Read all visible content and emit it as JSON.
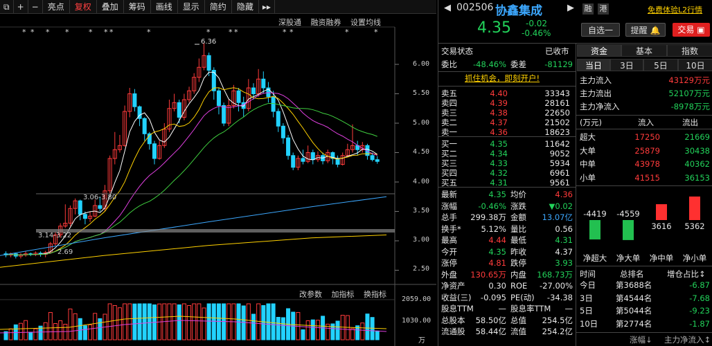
{
  "toolbar": {
    "items": [
      "亮点",
      "复权",
      "叠加",
      "筹码",
      "画线",
      "显示",
      "简约",
      "隐藏"
    ],
    "active": "复权"
  },
  "chart": {
    "sublinks_top": [
      "深股通",
      "融资融券",
      "设置均线"
    ],
    "sublinks_bottom": [
      "改参数",
      "加指标",
      "换指标"
    ],
    "price_labels": [
      "6.00",
      "5.50",
      "5.00",
      "4.50",
      "4.00",
      "3.50",
      "3.00",
      "2.50"
    ],
    "vol_labels": [
      "2059.00",
      "1030.00",
      "万"
    ],
    "annotations": {
      "high": "6.36",
      "mid": "3.06-3.80",
      "low": "3.14-3.22",
      "low2": "2.69"
    }
  },
  "stock": {
    "code": "002506",
    "name": "协鑫集成",
    "price": "4.35",
    "change": "-0.02",
    "change_pct": "-0.46%",
    "badges": [
      "融",
      "港"
    ],
    "promo": "免费体验L2行情",
    "buttons": {
      "watch": "自选一",
      "alert": "提醒",
      "trade": "交易"
    }
  },
  "trade_status": {
    "label": "交易状态",
    "status": "已收市",
    "weibi_label": "委比",
    "weibi": "-48.46%",
    "weicha_label": "委差",
    "weicha": "-81129",
    "promo": "抓住机会，即刻开户!"
  },
  "asks": [
    {
      "label": "卖五",
      "price": "4.40",
      "vol": "33343"
    },
    {
      "label": "卖四",
      "price": "4.39",
      "vol": "28161"
    },
    {
      "label": "卖三",
      "price": "4.38",
      "vol": "22650"
    },
    {
      "label": "卖二",
      "price": "4.37",
      "vol": "21502"
    },
    {
      "label": "卖一",
      "price": "4.36",
      "vol": "18623"
    }
  ],
  "bids": [
    {
      "label": "买一",
      "price": "4.35",
      "vol": "11642"
    },
    {
      "label": "买二",
      "price": "4.34",
      "vol": "9052"
    },
    {
      "label": "买三",
      "price": "4.33",
      "vol": "5934"
    },
    {
      "label": "买四",
      "price": "4.32",
      "vol": "6961"
    },
    {
      "label": "买五",
      "price": "4.31",
      "vol": "9561"
    }
  ],
  "quote": {
    "latest_l": "最新",
    "latest": "4.35",
    "avg_l": "均价",
    "avg": "4.36",
    "chgpct_l": "涨幅",
    "chgpct": "-0.46%",
    "chg_l": "涨跌",
    "chg": "▼0.02",
    "vol_l": "总手",
    "vol": "299.38万",
    "amt_l": "金额",
    "amt": "13.07亿",
    "turn_l": "换手*",
    "turn": "5.12%",
    "ratio_l": "量比",
    "ratio": "0.56",
    "high_l": "最高",
    "high": "4.44",
    "low_l": "最低",
    "low": "4.31",
    "open_l": "今开",
    "open": "4.35",
    "prev_l": "昨收",
    "prev": "4.37",
    "up_l": "涨停",
    "up": "4.81",
    "down_l": "跌停",
    "down": "3.93",
    "outer_l": "外盘",
    "outer": "130.65万",
    "inner_l": "内盘",
    "inner": "168.73万",
    "nav_l": "净资产",
    "nav": "0.30",
    "roe_l": "ROE",
    "roe": "-27.00%",
    "eps_l": "收益(三)",
    "eps": "-0.095",
    "pe_l": "PE(动)",
    "pe": "-34.38",
    "div_l": "股息TTM",
    "div": "—",
    "divr_l": "股息率TTM",
    "divr": "—",
    "cap_l": "总股本",
    "cap": "58.50亿",
    "mcap_l": "总值",
    "mcap": "254.5亿",
    "float_l": "流通股",
    "float": "58.44亿",
    "fmcap_l": "流值",
    "fmcap": "254.2亿"
  },
  "fund": {
    "tabs": [
      "资金",
      "基本",
      "指数"
    ],
    "periods": [
      "当日",
      "3日",
      "5日",
      "10日"
    ],
    "main_in_l": "主力流入",
    "main_in": "43129万元",
    "main_out_l": "主力流出",
    "main_out": "52107万元",
    "main_net_l": "主力净流入",
    "main_net": "-8978万元",
    "unit": "(万元)",
    "in_h": "流入",
    "out_h": "流出",
    "rows": [
      {
        "label": "超大",
        "in": "17250",
        "out": "21669"
      },
      {
        "label": "大单",
        "in": "25879",
        "out": "30438"
      },
      {
        "label": "中单",
        "in": "43978",
        "out": "40362"
      },
      {
        "label": "小单",
        "in": "41515",
        "out": "36153"
      }
    ],
    "net_bars": [
      {
        "label": "净超大",
        "value": -4419,
        "text": "-4419"
      },
      {
        "label": "净大单",
        "value": -4559,
        "text": "-4559"
      },
      {
        "label": "净中单",
        "value": 3616,
        "text": "3616"
      },
      {
        "label": "净小单",
        "value": 5362,
        "text": "5362"
      }
    ],
    "rank_h": {
      "time": "时间",
      "rank": "总排名",
      "pct": "增仓占比"
    },
    "ranks": [
      {
        "time": "今日",
        "rank": "第3688名",
        "pct": "-6.87"
      },
      {
        "time": "3日",
        "rank": "第4544名",
        "pct": "-7.68"
      },
      {
        "time": "5日",
        "rank": "第5044名",
        "pct": "-9.23"
      },
      {
        "time": "10日",
        "rank": "第2774名",
        "pct": "-1.87"
      }
    ],
    "footer": [
      "涨幅",
      "主力净流入"
    ]
  }
}
